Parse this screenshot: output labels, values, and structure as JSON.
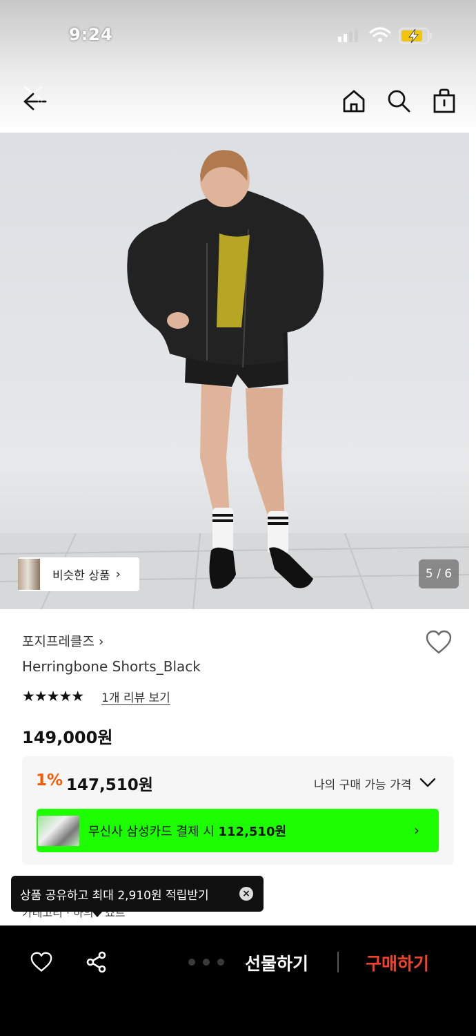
{
  "status_bar": {
    "time": "9:24"
  },
  "nav": {
    "back_icon": "back-arrow-icon",
    "home_icon": "home-icon",
    "search_icon": "search-icon",
    "cart_icon": "shopping-bag-icon"
  },
  "hero": {
    "similar_label": "비슷한 상품",
    "similar_chevron": "›",
    "counter": "5 / 6"
  },
  "product": {
    "brand": "포지프레클즈 ›",
    "name": "Herringbone Shorts_Black",
    "stars": "★★★★★",
    "rating": 5,
    "review_link": "1개 리뷰 보기",
    "price": "149,000원"
  },
  "price_box": {
    "discount_rate": "1%",
    "discount_price": "147,510원",
    "my_price_label": "나의 구매 가능 가격",
    "card_text_prefix": "무신사 삼성카드 결제 시 ",
    "card_price": "112,510원",
    "card_chevron": "›"
  },
  "breadcrumb": "카테고리 · 하의 › 쇼트",
  "tooltip": {
    "text": "상품 공유하고 최대 2,910원 적립받기",
    "close": "×"
  },
  "bottom_bar": {
    "gift_label": "선물하기",
    "buy_label": "구매하기"
  },
  "colors": {
    "discount": "#f25c05",
    "card_banner": "#1dff00",
    "buy": "#f2422a"
  }
}
